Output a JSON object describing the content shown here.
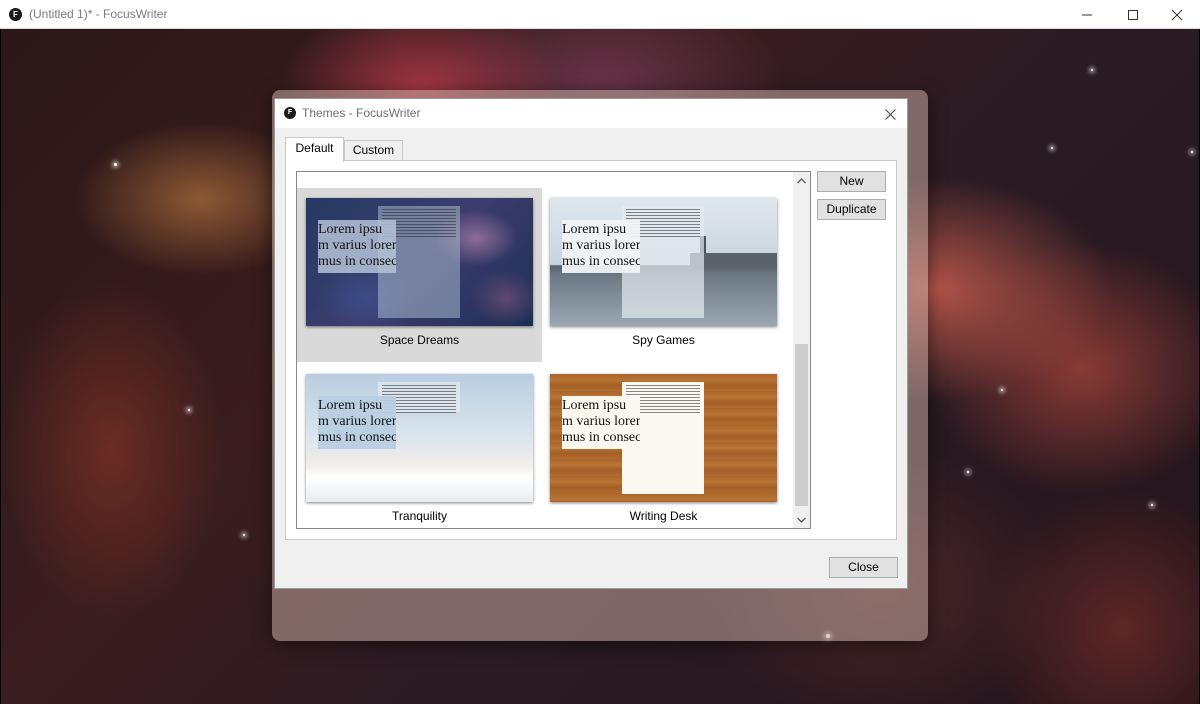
{
  "window": {
    "title": "(Untitled 1)* - FocusWriter",
    "app_icon_letter": "F"
  },
  "dialog": {
    "title": "Themes - FocusWriter",
    "tabs": [
      {
        "label": "Default",
        "active": true
      },
      {
        "label": "Custom",
        "active": false
      }
    ],
    "themes": [
      {
        "name": "Space Dreams",
        "selected": true
      },
      {
        "name": "Spy Games",
        "selected": false
      },
      {
        "name": "Tranquility",
        "selected": false
      },
      {
        "name": "Writing Desk",
        "selected": false
      }
    ],
    "preview_text": [
      "Lorem ipsu",
      "m varius lorem",
      "mus in consect"
    ],
    "buttons": {
      "new": "New",
      "duplicate": "Duplicate",
      "close": "Close"
    }
  },
  "icons": {
    "minimize": "minimize-icon",
    "maximize": "maximize-icon",
    "close": "close-icon",
    "scroll_up": "chevron-up-icon",
    "scroll_down": "chevron-down-icon"
  }
}
